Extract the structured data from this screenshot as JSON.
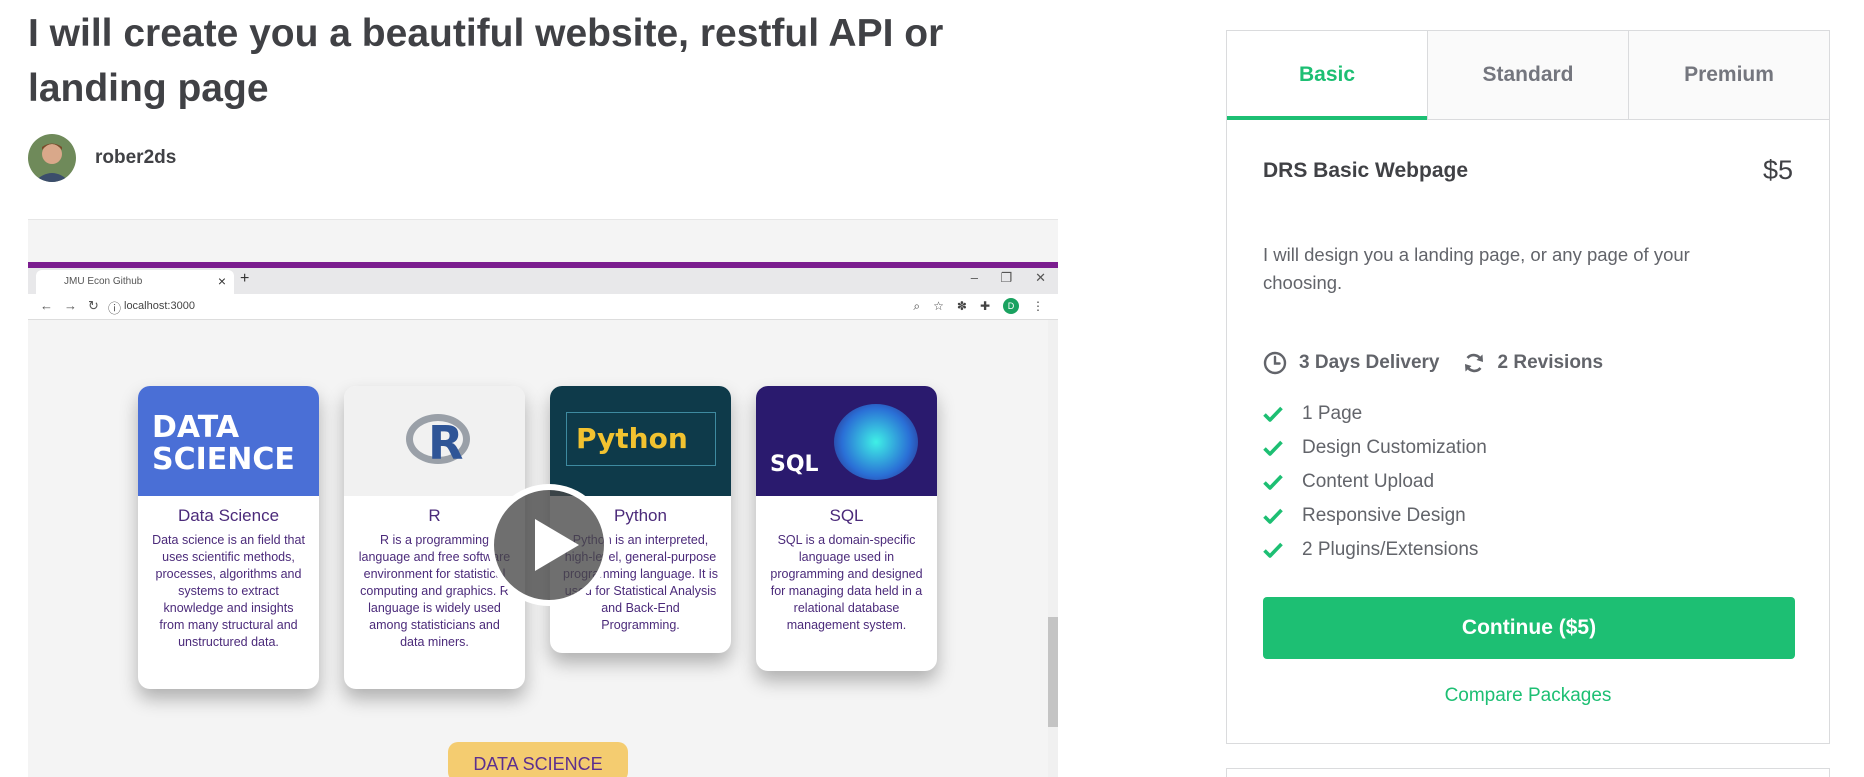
{
  "gig": {
    "title": "I will create you a beautiful website, restful API or landing page",
    "seller_name": "rober2ds"
  },
  "media": {
    "browser_tab": "JMU Econ Github",
    "address": "localhost:3000",
    "profile_initial": "D",
    "cards": [
      {
        "title": "Data Science",
        "img_label": "DATA SCIENCE",
        "body": "Data science is an field that uses scientific methods, processes, algorithms and systems to extract knowledge and insights from many structural and unstructured data."
      },
      {
        "title": "R",
        "img_label": "R",
        "body": "R is a programming language and free software environment for statistical computing and graphics. R language is widely used among statisticians and data miners."
      },
      {
        "title": "Python",
        "img_label": "Python",
        "body": "Python is an interpreted, high-level, general-purpose programming language. It is used for Statistical Analysis and Back-End Programming."
      },
      {
        "title": "SQL",
        "img_label": "SQL",
        "body": "SQL is a domain-specific language used in programming and designed for managing data held in a relational database management system."
      }
    ],
    "pill_label": "DATA SCIENCE"
  },
  "package": {
    "tabs": [
      {
        "label": "Basic",
        "active": true
      },
      {
        "label": "Standard",
        "active": false
      },
      {
        "label": "Premium",
        "active": false
      }
    ],
    "name": "DRS Basic Webpage",
    "price": "$5",
    "description": "I will design you a landing page, or any page of your choosing.",
    "delivery": "3 Days Delivery",
    "revisions": "2 Revisions",
    "features": [
      "1 Page",
      "Design Customization",
      "Content Upload",
      "Responsive Design",
      "2 Plugins/Extensions"
    ],
    "continue_label": "Continue ($5)",
    "compare_label": "Compare Packages"
  },
  "colors": {
    "accent": "#1dbf73",
    "text": "#404145",
    "muted": "#62646a",
    "browser_bar": "#7b1d8f"
  },
  "icons": [
    "clock-icon",
    "refresh-icon",
    "check-icon",
    "play-icon"
  ]
}
